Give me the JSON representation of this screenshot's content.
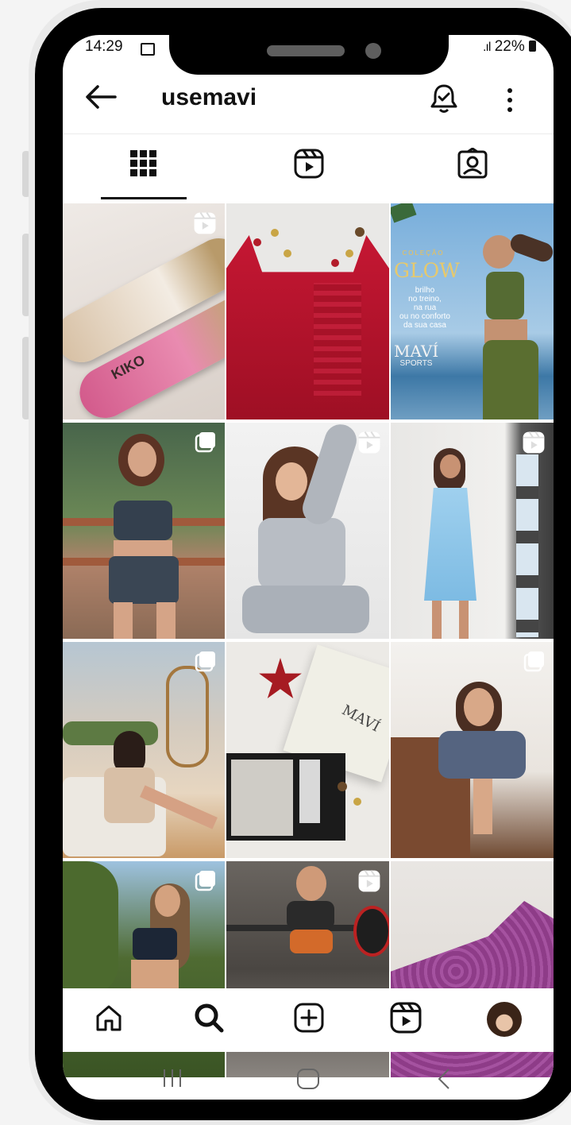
{
  "status_bar": {
    "time": "14:29",
    "battery": "22%"
  },
  "profile": {
    "username": "usemavi"
  },
  "tabs": [
    {
      "name": "posts-grid",
      "active": true
    },
    {
      "name": "reels",
      "active": false
    },
    {
      "name": "tagged",
      "active": false
    }
  ],
  "grid": {
    "tile_3_title": "GLOW",
    "tile_3_subtitle": "brilho\nno treino,\nna rua\nou no conforto\nda sua casa",
    "tile_3_brand": "MAVÍ",
    "tile_3_brand_sub": "SPORTS",
    "tile_1_label": "KIKO",
    "tile_8_label": "MAVÍ"
  },
  "colors": {
    "accent": "#111111",
    "red_product": "#b8142b",
    "sky_blue": "#6ea7d3"
  }
}
